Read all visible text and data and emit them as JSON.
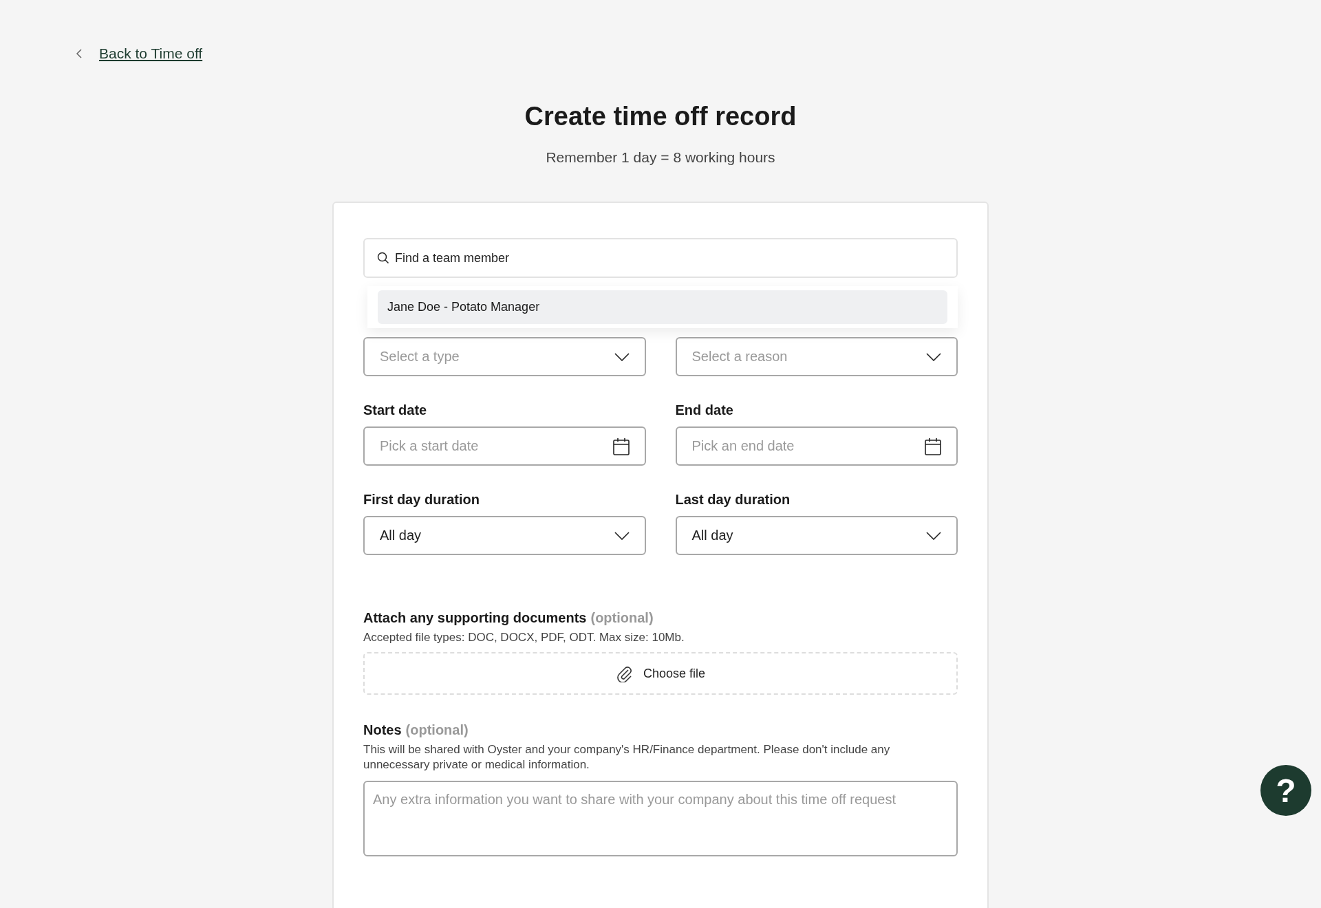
{
  "back_link": {
    "label": "Back to Time off"
  },
  "header": {
    "title": "Create time off record",
    "subtitle": "Remember 1 day = 8 working hours"
  },
  "search": {
    "placeholder": "Find a team member"
  },
  "search_results": [
    {
      "label": "Jane Doe - Potato Manager",
      "selected": true
    }
  ],
  "select_row": [
    {
      "placeholder": "Select a type"
    },
    {
      "placeholder": "Select a reason"
    }
  ],
  "date_fields": [
    {
      "label": "Start date",
      "placeholder": "Pick a start date"
    },
    {
      "label": "End date",
      "placeholder": "Pick an end date"
    }
  ],
  "duration_fields": [
    {
      "label": "First day duration",
      "value": "All day"
    },
    {
      "label": "Last day duration",
      "value": "All day"
    }
  ],
  "attachments": {
    "label": "Attach any supporting documents",
    "optional": "(optional)",
    "hint": "Accepted file types: DOC, DOCX, PDF, ODT. Max size: 10Mb.",
    "button": "Choose file"
  },
  "notes": {
    "label": "Notes",
    "optional": "(optional)",
    "hint": "This will be shared with Oyster and your company's HR/Finance department. Please don't include any unnecessary private or medical information.",
    "placeholder": "Any extra information you want to share with your company about this time off request"
  },
  "help_button": {
    "label": "?"
  }
}
